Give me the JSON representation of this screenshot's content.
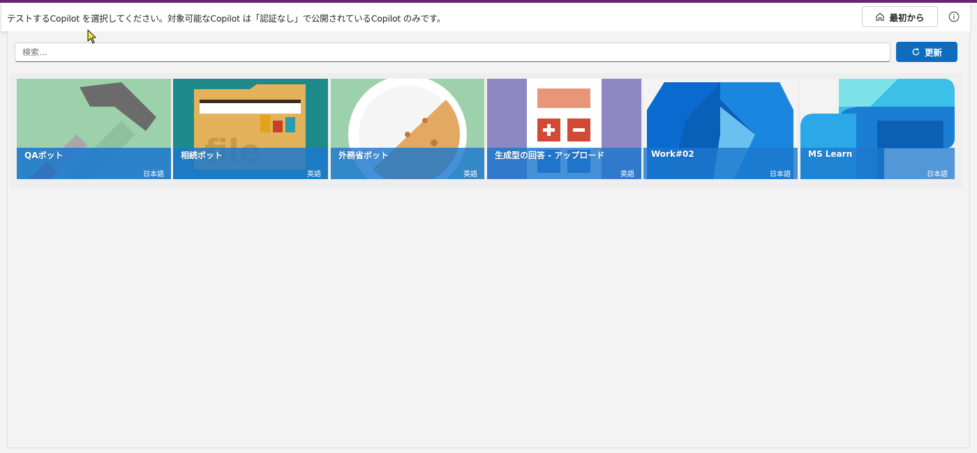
{
  "header": {
    "instruction": "テストするCopilot を選択してください。対象可能なCopilot は「認証なし」で公開されているCopilot のみです。",
    "home_label": "最初から",
    "home_icon": "home-icon",
    "info_icon": "info-icon",
    "accent_color": "#6b2470"
  },
  "search": {
    "placeholder": "検索...",
    "value": ""
  },
  "refresh": {
    "label": "更新",
    "icon": "refresh-icon",
    "color": "#0f6cbd"
  },
  "cards": [
    {
      "title": "QAボット",
      "language": "日本語",
      "icon": "hammer-icon"
    },
    {
      "title": "相続ボット",
      "language": "英語",
      "icon": "file-folder-icon"
    },
    {
      "title": "外務省ボット",
      "language": "英語",
      "icon": "cookie-plate-icon"
    },
    {
      "title": "生成型の回答 - アップロード",
      "language": "英語",
      "icon": "calculator-icon"
    },
    {
      "title": "Work#02",
      "language": "日本語",
      "icon": "copilot-logo-icon"
    },
    {
      "title": "MS Learn",
      "language": "日本語",
      "icon": "copilot-studio-logo-icon"
    }
  ]
}
